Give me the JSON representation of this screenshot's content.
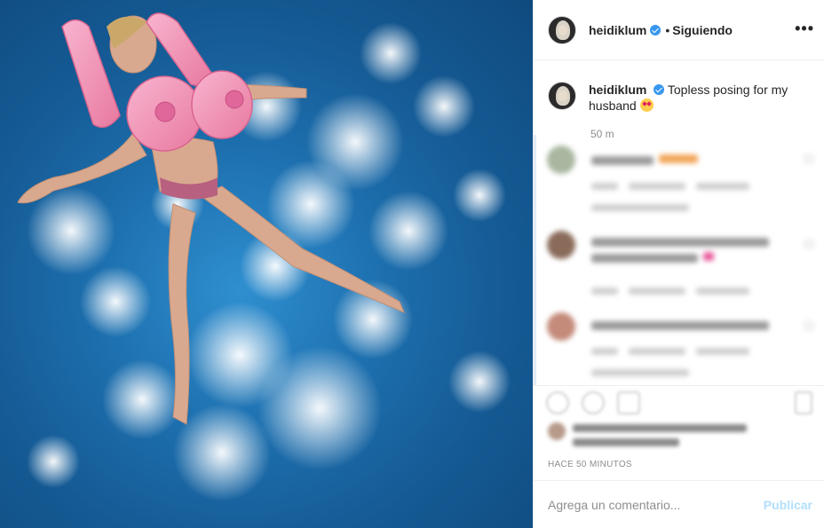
{
  "post": {
    "username": "heidiklum",
    "follow_separator": "•",
    "follow_label": "Siguiendo",
    "more_label": "•••",
    "caption_username": "heidiklum",
    "caption_text": "Topless posing for my husband",
    "caption_time": "50 m",
    "timestamp": "HACE 50 MINUTOS"
  },
  "comment_box": {
    "placeholder": "Agrega un comentario...",
    "publish_label": "Publicar"
  },
  "icons": {
    "verified": "verified-badge-icon",
    "more": "more-options-icon",
    "like": "heart-icon",
    "comment": "comment-icon",
    "share": "share-icon",
    "save": "bookmark-icon"
  },
  "colors": {
    "accent": "#3897f0",
    "publish_disabled": "#b2dffc",
    "water": "#1d6fae",
    "float": "#f39bbd"
  }
}
